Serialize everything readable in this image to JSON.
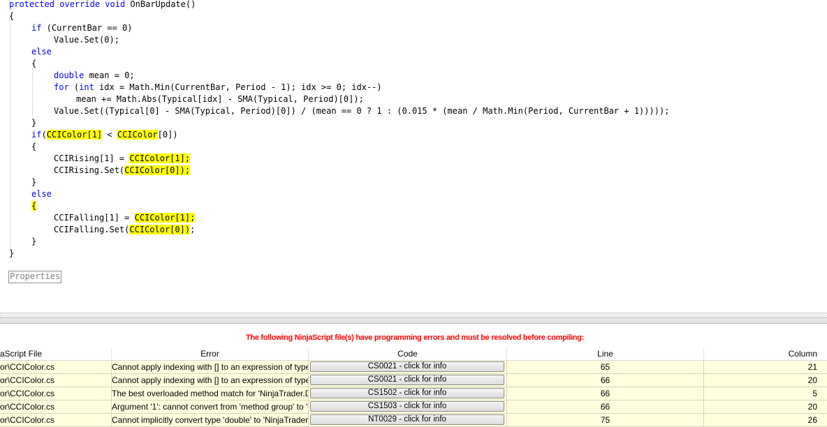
{
  "editor": {
    "lines": [
      {
        "indent": 0,
        "tokens": [
          {
            "t": "protected override void",
            "c": "kw"
          },
          {
            "t": " OnBarUpdate()"
          }
        ]
      },
      {
        "indent": 0,
        "tokens": [
          {
            "t": "{"
          }
        ]
      },
      {
        "indent": 1,
        "tokens": [
          {
            "t": "if",
            "c": "kw"
          },
          {
            "t": " (CurrentBar == 0)"
          }
        ]
      },
      {
        "indent": 2,
        "tokens": [
          {
            "t": "Value.Set(0);"
          }
        ]
      },
      {
        "indent": 1,
        "tokens": [
          {
            "t": "else",
            "c": "kw"
          }
        ]
      },
      {
        "indent": 1,
        "tokens": [
          {
            "t": "{"
          }
        ]
      },
      {
        "indent": 2,
        "tokens": [
          {
            "t": "double",
            "c": "kw"
          },
          {
            "t": " mean = 0;"
          }
        ]
      },
      {
        "indent": 2,
        "tokens": [
          {
            "t": "for",
            "c": "kw"
          },
          {
            "t": " ("
          },
          {
            "t": "int",
            "c": "kw"
          },
          {
            "t": " idx = Math.Min(CurrentBar, Period - 1); idx >= 0; idx--)"
          }
        ]
      },
      {
        "indent": 3,
        "tokens": [
          {
            "t": "mean += Math.Abs(Typical[idx] - SMA(Typical, Period)[0]);"
          }
        ]
      },
      {
        "indent": 2,
        "tokens": [
          {
            "t": "Value.Set((Typical[0] - SMA(Typical, Period)[0]) / (mean == 0 ? 1 : (0.015 * (mean / Math.Min(Period, CurrentBar + 1)))));"
          }
        ]
      },
      {
        "indent": 1,
        "tokens": [
          {
            "t": "}"
          }
        ]
      },
      {
        "indent": 1,
        "tokens": [
          {
            "t": "if",
            "c": "kw"
          },
          {
            "t": "("
          },
          {
            "t": "CCIColor[1]",
            "c": "hl"
          },
          {
            "t": " < "
          },
          {
            "t": "CCIColor",
            "c": "hl"
          },
          {
            "t": "[0])"
          }
        ]
      },
      {
        "indent": 1,
        "tokens": [
          {
            "t": "{"
          }
        ]
      },
      {
        "indent": 2,
        "tokens": [
          {
            "t": "CCIRising[1] = "
          },
          {
            "t": "CCIColor[1];",
            "c": "hl"
          }
        ]
      },
      {
        "indent": 2,
        "tokens": [
          {
            "t": "CCIRising.Set("
          },
          {
            "t": "CCIColor[0]);",
            "c": "hl"
          }
        ]
      },
      {
        "indent": 1,
        "tokens": [
          {
            "t": "}"
          }
        ]
      },
      {
        "indent": 1,
        "tokens": [
          {
            "t": "else",
            "c": "kw"
          }
        ]
      },
      {
        "indent": 1,
        "tokens": [
          {
            "t": "{",
            "c": "hl"
          }
        ]
      },
      {
        "indent": 2,
        "tokens": [
          {
            "t": "CCIFalling[1] = "
          },
          {
            "t": "CCIColor[1];",
            "c": "hl"
          }
        ]
      },
      {
        "indent": 2,
        "tokens": [
          {
            "t": "CCIFalling.Set("
          },
          {
            "t": "CCIColor[0])",
            "c": "hl"
          },
          {
            "t": ";"
          }
        ]
      },
      {
        "indent": 1,
        "tokens": [
          {
            "t": "}"
          }
        ]
      },
      {
        "indent": 0,
        "tokens": [
          {
            "t": "}"
          }
        ]
      }
    ],
    "collapsed_region_label": "Properties"
  },
  "error_panel": {
    "message": "The following NinjaScript file(s) have programming errors and must be resolved before compiling:",
    "columns": [
      "aScript File",
      "Error",
      "Code",
      "Line",
      "Column"
    ],
    "rows": [
      {
        "file": "or\\CCIColor.cs",
        "error": "Cannot apply indexing with [] to an expression of type '",
        "code": "CS0021 - click for info",
        "line": "65",
        "column": "21"
      },
      {
        "file": "or\\CCIColor.cs",
        "error": "Cannot apply indexing with [] to an expression of type '",
        "code": "CS0021 - click for info",
        "line": "66",
        "column": "20"
      },
      {
        "file": "or\\CCIColor.cs",
        "error": "The best overloaded method match for 'NinjaTrader.D",
        "code": "CS1502 - click for info",
        "line": "66",
        "column": "5"
      },
      {
        "file": "or\\CCIColor.cs",
        "error": "Argument '1': cannot convert from 'method group' to 'd",
        "code": "CS1503 - click for info",
        "line": "66",
        "column": "20"
      },
      {
        "file": "or\\CCIColor.cs",
        "error": "Cannot implicitly convert type 'double' to 'NinjaTrader.",
        "code": "NT0029 - click for info",
        "line": "75",
        "column": "26"
      }
    ]
  },
  "colors": {
    "keyword": "#0000ff",
    "highlight": "#ffff00",
    "error_message": "#ff0000",
    "grid_row_background": "#fffedd"
  }
}
